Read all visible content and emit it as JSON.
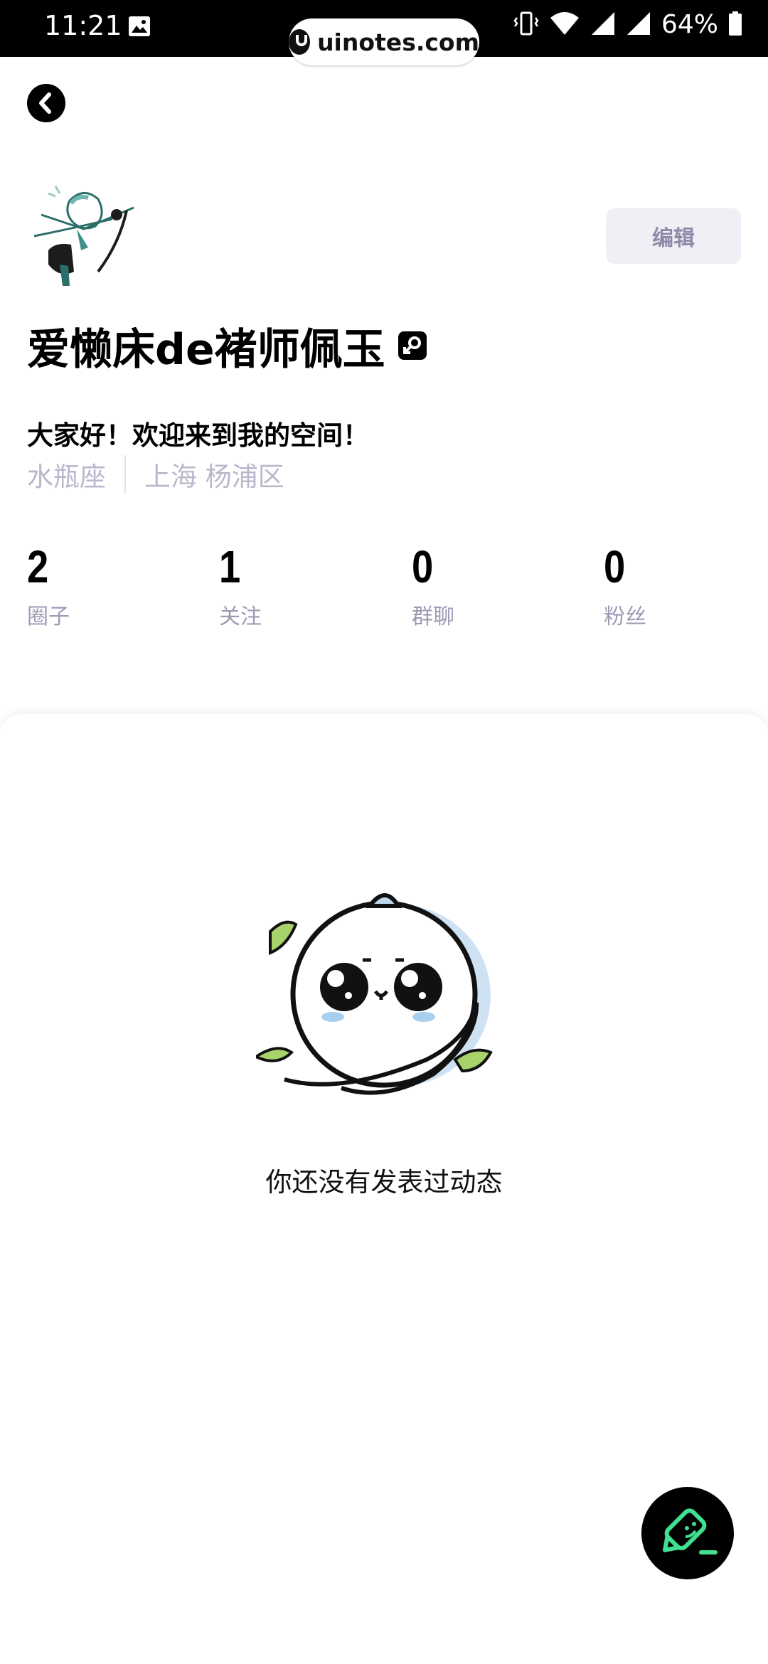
{
  "status_bar": {
    "time": "11:21",
    "battery": "64%"
  },
  "watermark": {
    "text": "uinotes.com"
  },
  "profile": {
    "edit_label": "编辑",
    "username": "爱懒床de褚师佩玉",
    "bio": "大家好！欢迎来到我的空间！",
    "zodiac": "水瓶座",
    "location": "上海 杨浦区"
  },
  "stats": [
    {
      "value": "2",
      "label": "圈子"
    },
    {
      "value": "1",
      "label": "关注"
    },
    {
      "value": "0",
      "label": "群聊"
    },
    {
      "value": "0",
      "label": "粉丝"
    }
  ],
  "feed": {
    "empty_message": "你还没有发表过动态"
  },
  "colors": {
    "fab_icon": "#3fe08f",
    "muted_text": "#9c9ab4"
  }
}
